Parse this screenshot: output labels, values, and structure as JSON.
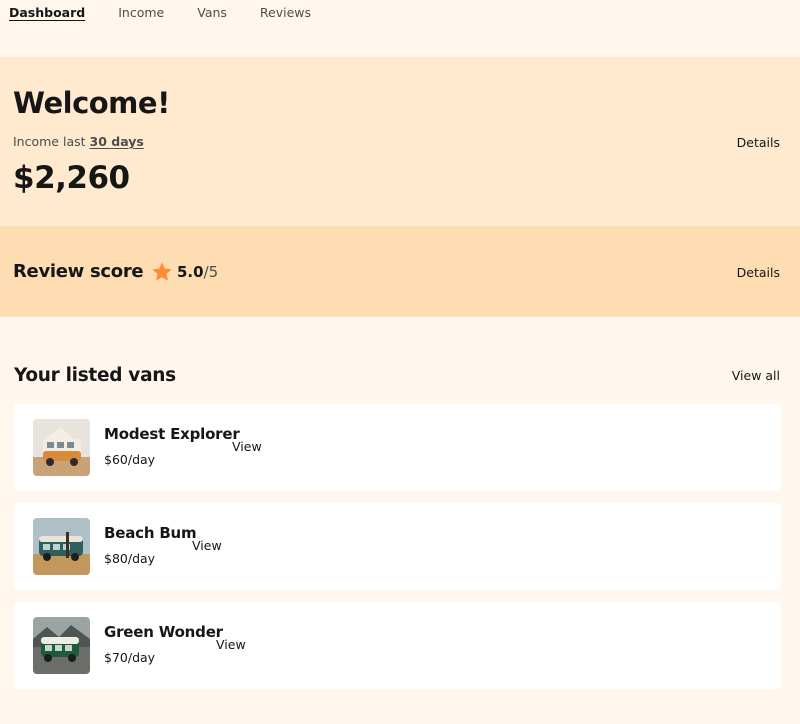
{
  "nav": {
    "items": [
      {
        "label": "Dashboard",
        "active": true
      },
      {
        "label": "Income",
        "active": false
      },
      {
        "label": "Vans",
        "active": false
      },
      {
        "label": "Reviews",
        "active": false
      }
    ]
  },
  "income": {
    "title": "Welcome!",
    "subtitle_prefix": "Income last",
    "subtitle_period": "30 days",
    "amount": "$2,260",
    "details_label": "Details",
    "bg_color": "#FFEAD0"
  },
  "review": {
    "title": "Review score",
    "star_icon": "star-icon",
    "star_color": "#FF8C38",
    "score": "5.0",
    "score_max": "/5",
    "details_label": "Details",
    "bg_color": "#FFDDB2"
  },
  "vans": {
    "title": "Your listed vans",
    "view_all_label": "View all",
    "items": [
      {
        "name": "Modest Explorer",
        "price": "$60/day",
        "view_label": "View"
      },
      {
        "name": "Beach Bum",
        "price": "$80/day",
        "view_label": "View"
      },
      {
        "name": "Green Wonder",
        "price": "$70/day",
        "view_label": "View"
      }
    ]
  }
}
